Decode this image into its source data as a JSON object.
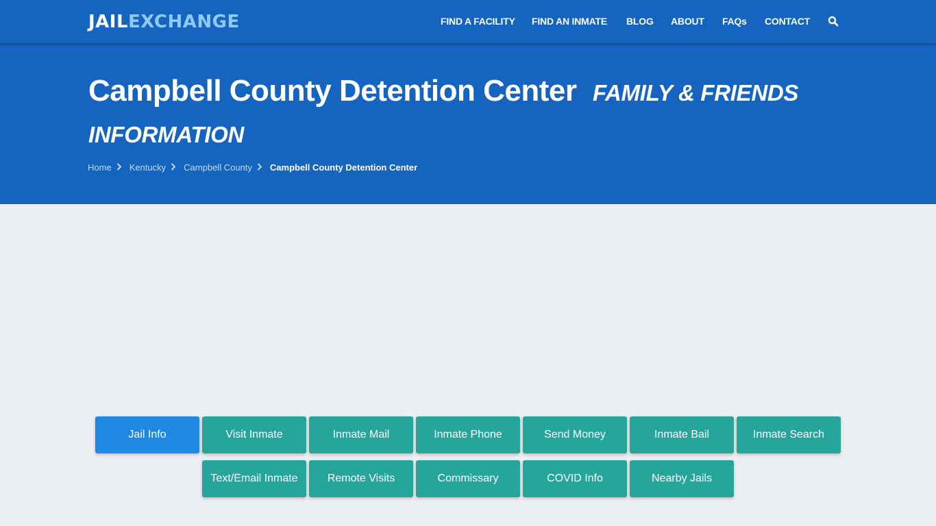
{
  "logo": {
    "part1": "JAIL",
    "part2": "EXCHANGE"
  },
  "nav": {
    "items": [
      {
        "label": "FIND A FACILITY"
      },
      {
        "label": "FIND AN INMATE"
      },
      {
        "label": "BLOG"
      },
      {
        "label": "ABOUT"
      },
      {
        "label": "FAQs"
      },
      {
        "label": "CONTACT"
      }
    ],
    "search_icon": "search-icon"
  },
  "hero": {
    "title": "Campbell County Detention Center",
    "subtitle": "FAMILY & FRIENDS INFORMATION",
    "breadcrumb": [
      {
        "label": "Home"
      },
      {
        "label": "Kentucky"
      },
      {
        "label": "Campbell County"
      },
      {
        "label": "Campbell County Detention Center"
      }
    ]
  },
  "buttons": [
    {
      "label": "Jail Info",
      "active": true
    },
    {
      "label": "Visit Inmate"
    },
    {
      "label": "Inmate Mail"
    },
    {
      "label": "Inmate Phone"
    },
    {
      "label": "Send Money"
    },
    {
      "label": "Inmate Bail"
    },
    {
      "label": "Inmate Search"
    },
    {
      "label": "Text/Email Inmate"
    },
    {
      "label": "Remote Visits"
    },
    {
      "label": "Commissary"
    },
    {
      "label": "COVID Info"
    },
    {
      "label": "Nearby Jails"
    }
  ],
  "colors": {
    "brand_blue": "#1565c0",
    "logo_accent": "#90caf9",
    "button_teal": "#26a69a",
    "button_active": "#1e88e5",
    "page_bg": "#ebeef2"
  }
}
